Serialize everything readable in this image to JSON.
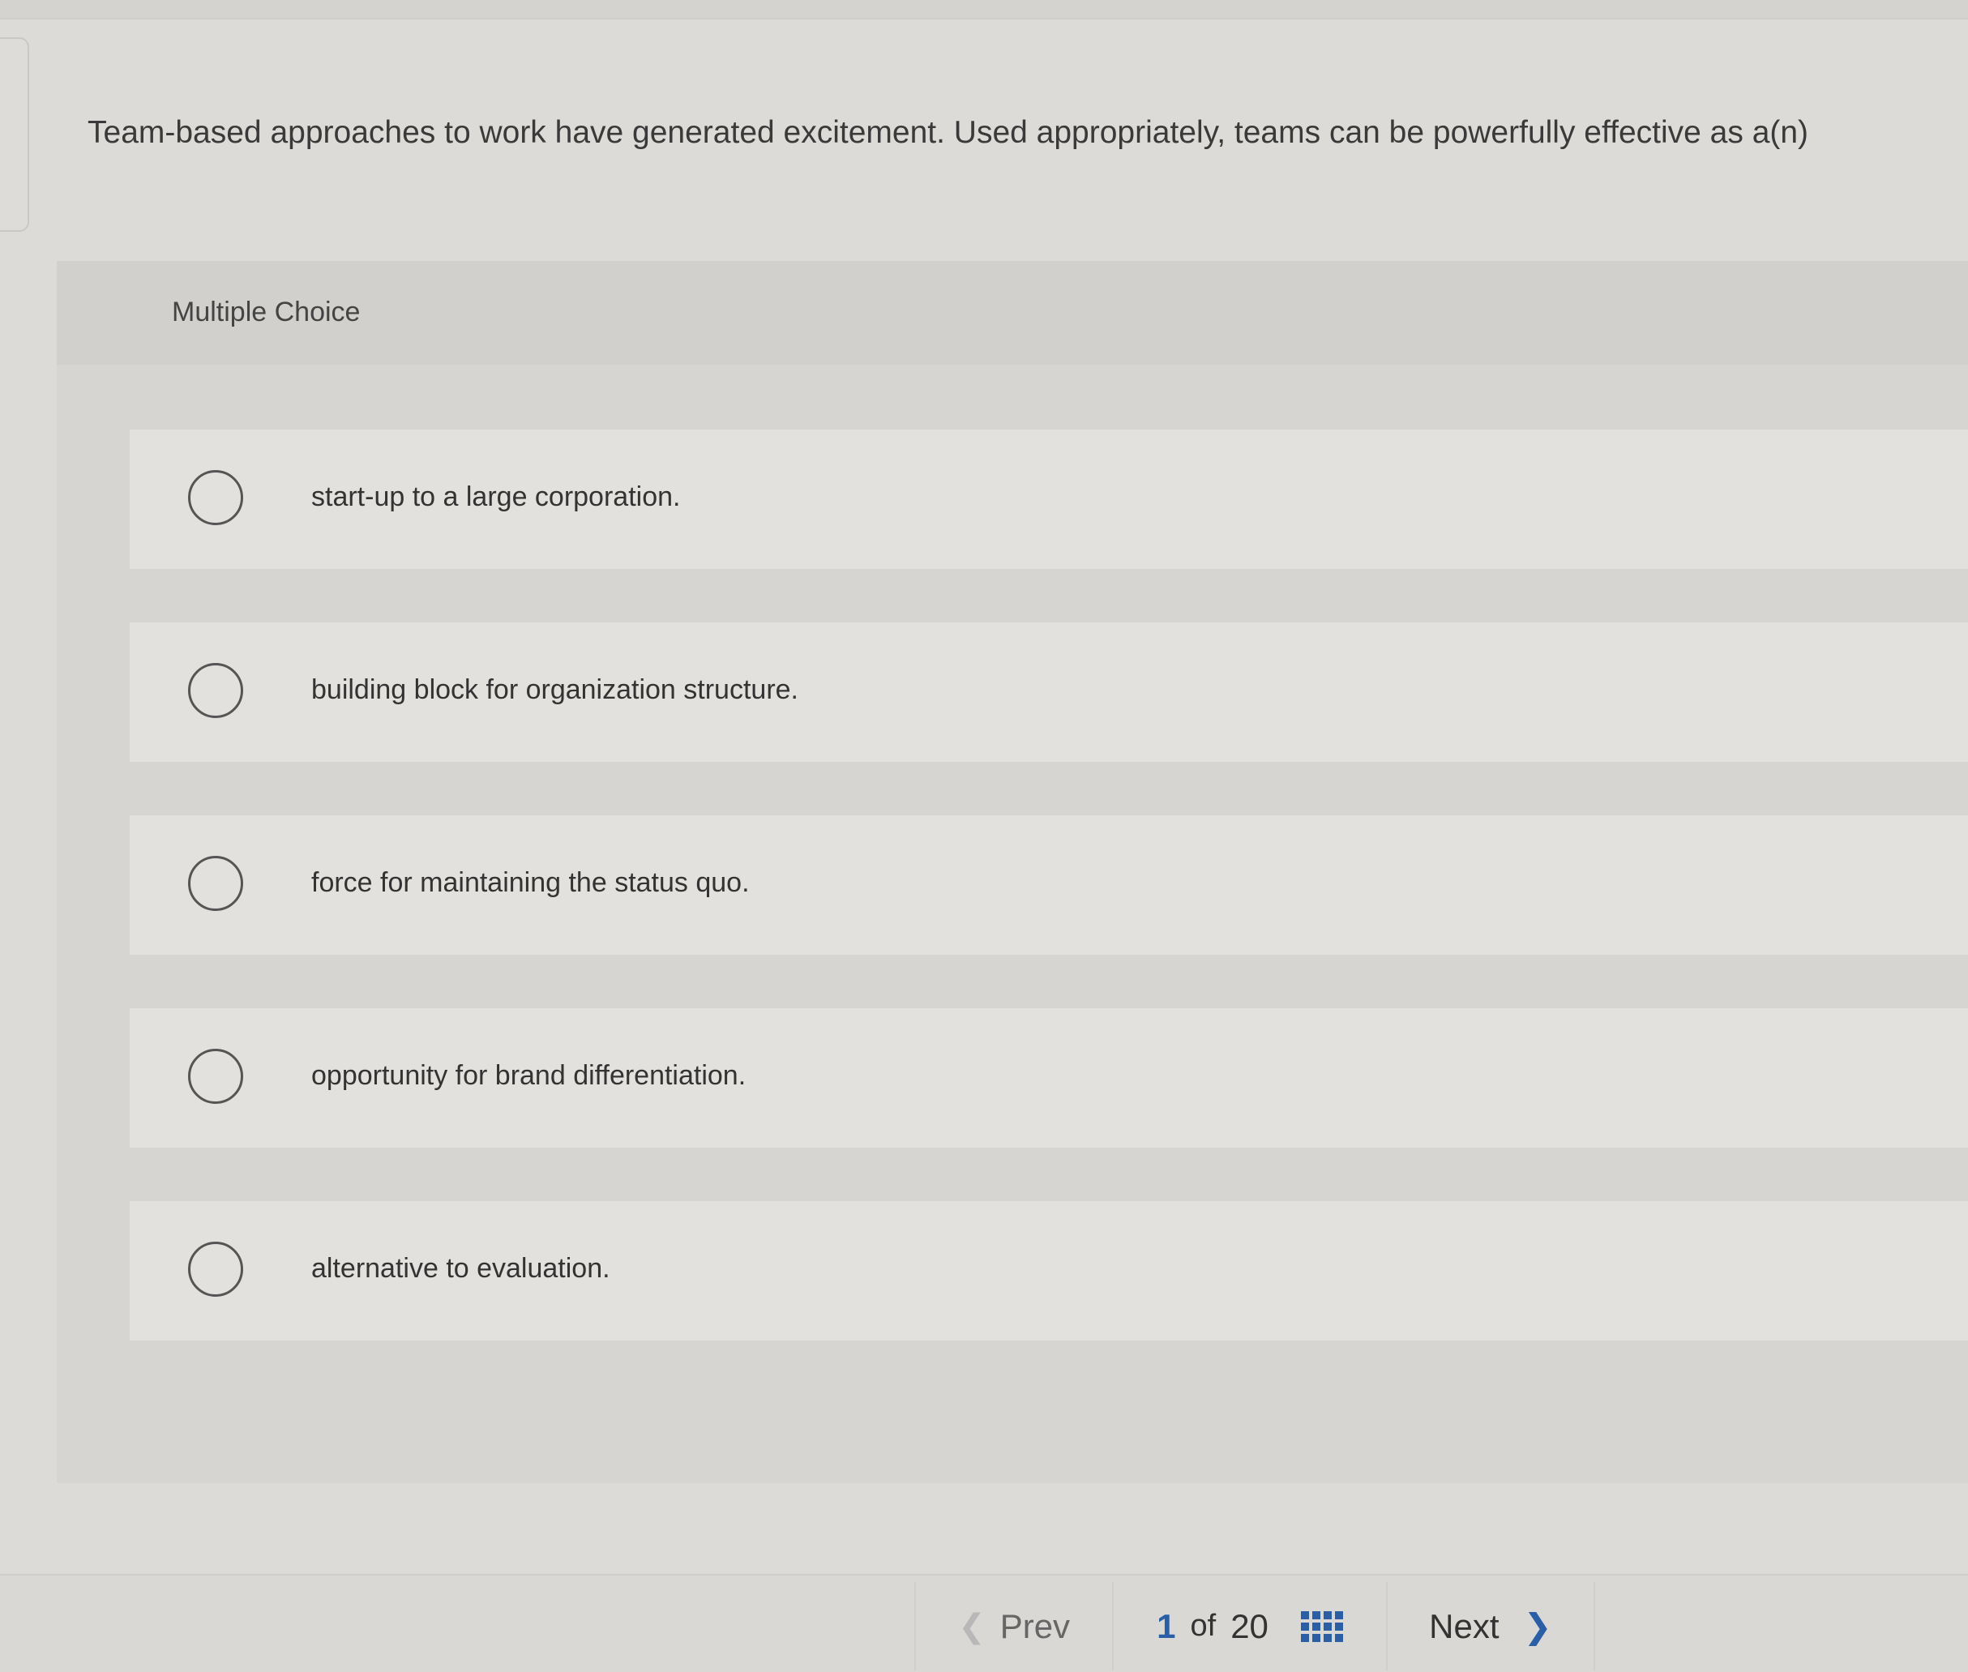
{
  "question": {
    "text": "Team-based approaches to work have generated excitement. Used appropriately, teams can be powerfully effective as a(n)"
  },
  "panel": {
    "title": "Multiple Choice"
  },
  "choices": [
    {
      "label": "start-up to a large corporation."
    },
    {
      "label": "building block for organization structure."
    },
    {
      "label": "force for maintaining the status quo."
    },
    {
      "label": "opportunity for brand differentiation."
    },
    {
      "label": "alternative to evaluation."
    }
  ],
  "pager": {
    "prev_label": "Prev",
    "current": "1",
    "of_label": "of",
    "total": "20",
    "next_label": "Next",
    "prev_icon": "chevron-left-icon",
    "next_icon": "chevron-right-icon",
    "grid_icon": "grid-icon"
  },
  "colors": {
    "accent": "#2a5fa8",
    "background": "#dcdbd7"
  }
}
